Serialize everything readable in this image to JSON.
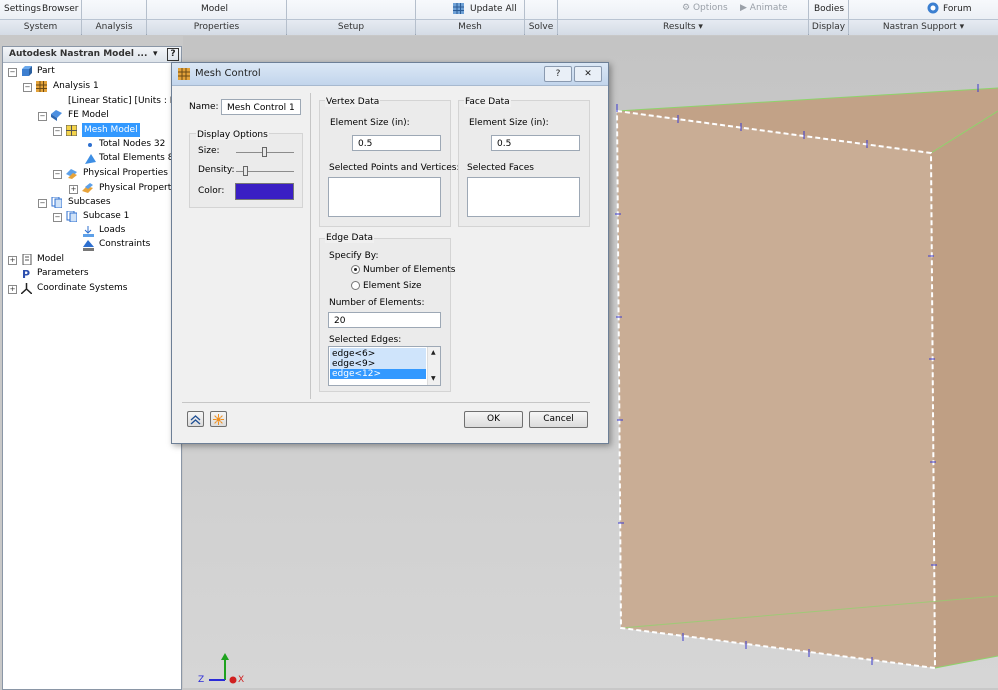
{
  "ribbon": {
    "system": {
      "settings": "Settings",
      "browser": "Browser",
      "label": "System"
    },
    "analysis": {
      "label": "Analysis"
    },
    "properties": {
      "model": "Model",
      "label": "Properties"
    },
    "setup": {
      "label": "Setup"
    },
    "mesh": {
      "update": "Update",
      "all": "All",
      "label": "Mesh"
    },
    "solve": {
      "label": "Solve"
    },
    "results": {
      "options": "Options",
      "animate": "Animate",
      "label": "Results ▾"
    },
    "display": {
      "bodies": "Bodies",
      "label": "Display"
    },
    "support": {
      "forum": "Forum",
      "label": "Nastran Support ▾"
    }
  },
  "browser": {
    "title": "Autodesk Nastran Model ...",
    "help": "?",
    "items": [
      {
        "label": "Part",
        "icon": "part-icon"
      },
      {
        "label": "Analysis 1",
        "icon": "analysis-icon"
      },
      {
        "label": "[Linear Static] [Units : De"
      },
      {
        "label": "FE Model",
        "icon": "fe-model-icon"
      },
      {
        "label": "Mesh Model",
        "icon": "mesh-model-icon"
      },
      {
        "label": "Total Nodes 32",
        "icon": "node-icon"
      },
      {
        "label": "Total Elements 8",
        "icon": "element-icon"
      },
      {
        "label": "Physical Properties",
        "icon": "physical-properties-icon"
      },
      {
        "label": "Physical Property",
        "icon": "physical-property-icon"
      },
      {
        "label": "Subcases",
        "icon": "subcases-icon"
      },
      {
        "label": "Subcase 1",
        "icon": "subcase-icon"
      },
      {
        "label": "Loads",
        "icon": "loads-icon"
      },
      {
        "label": "Constraints",
        "icon": "constraints-icon"
      },
      {
        "label": "Model",
        "icon": "model-icon"
      },
      {
        "label": "Parameters",
        "icon": "parameters-icon"
      },
      {
        "label": "Coordinate Systems",
        "icon": "coordinate-systems-icon"
      }
    ]
  },
  "dialog": {
    "title": "Mesh Control",
    "help_btn": "?",
    "close_btn": "✕",
    "name_label": "Name:",
    "name_value": "Mesh Control 1",
    "display_options": {
      "title": "Display Options",
      "size": "Size:",
      "density": "Density:",
      "color": "Color:",
      "swatch": "#3a1fc4"
    },
    "vertex": {
      "title": "Vertex Data",
      "size_label": "Element Size (in):",
      "size_value": "0.5",
      "selected_label": "Selected Points and Vertices:"
    },
    "face": {
      "title": "Face Data",
      "size_label": "Element Size (in):",
      "size_value": "0.5",
      "selected_label": "Selected Faces"
    },
    "edge": {
      "title": "Edge Data",
      "specify_by": "Specify By:",
      "opt_number": "Number of Elements",
      "opt_size": "Element Size",
      "num_label": "Number of Elements:",
      "num_value": "20",
      "selected_label": "Selected Edges:",
      "edges": [
        "edge<6>",
        "edge<9>",
        "edge<12>"
      ]
    },
    "ok": "OK",
    "cancel": "Cancel"
  },
  "triad": {
    "z": "Z",
    "x": "X"
  },
  "colors": {
    "selection": "#3399ff",
    "tree_selection": "#3399ff",
    "box_face": "#c9a88a",
    "edge_green": "#8ed46b"
  }
}
